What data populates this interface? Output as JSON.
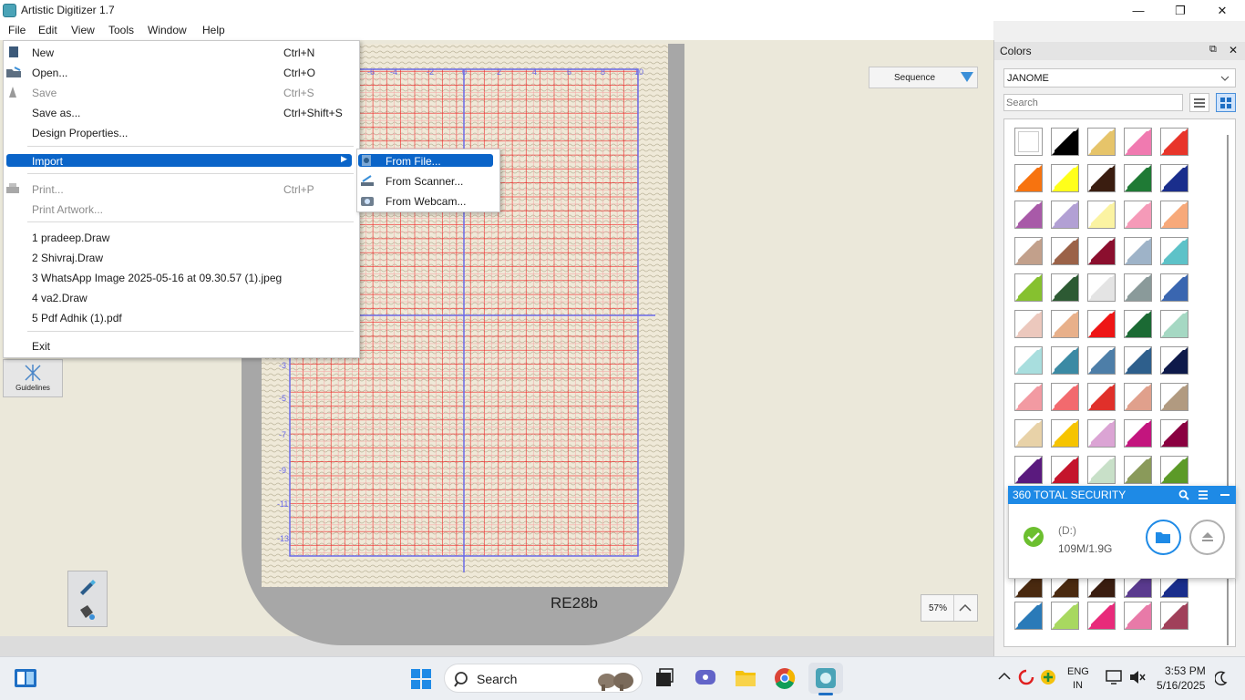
{
  "window": {
    "title": "Artistic Digitizer 1.7",
    "min": "—",
    "max": "❐",
    "close": "✕"
  },
  "menubar": [
    "File",
    "Edit",
    "View",
    "Tools",
    "Window",
    "Help"
  ],
  "file_menu": {
    "items": [
      {
        "label": "New",
        "shortcut": "Ctrl+N"
      },
      {
        "label": "Open...",
        "shortcut": "Ctrl+O"
      },
      {
        "label": "Save",
        "shortcut": "Ctrl+S"
      },
      {
        "label": "Save as...",
        "shortcut": "Ctrl+Shift+S"
      },
      {
        "label": "Design Properties...",
        "shortcut": ""
      },
      {
        "label": "Import",
        "shortcut": ""
      },
      {
        "label": "Print...",
        "shortcut": "Ctrl+P"
      },
      {
        "label": "Print Artwork...",
        "shortcut": ""
      },
      {
        "label": "1 pradeep.Draw",
        "shortcut": ""
      },
      {
        "label": "2 Shivraj.Draw",
        "shortcut": ""
      },
      {
        "label": "3 WhatsApp Image 2025-05-16 at 09.30.57 (1).jpeg",
        "shortcut": ""
      },
      {
        "label": "4 va2.Draw",
        "shortcut": ""
      },
      {
        "label": "5 Pdf Adhik (1).pdf",
        "shortcut": ""
      },
      {
        "label": "Exit",
        "shortcut": ""
      }
    ]
  },
  "import_submenu": [
    "From File...",
    "From Scanner...",
    "From Webcam..."
  ],
  "canvas": {
    "sequence_label": "Sequence",
    "hoop_label": "RE28b",
    "guidelines_label": "Guidelines",
    "zoom": "57%",
    "ruler_top": [
      "-6",
      "-4",
      "-2",
      "0",
      "2",
      "4",
      "6",
      "8",
      "10"
    ],
    "ruler_left": [
      "-3",
      "-5",
      "-7",
      "-9",
      "-11",
      "-13"
    ]
  },
  "colors_panel": {
    "title": "Colors",
    "brand": "JANOME",
    "search_placeholder": "Search",
    "swatches": [
      [
        "#ffffff",
        "#000000",
        "#e6c46a",
        "#f07ab0",
        "#e8352a"
      ],
      [
        "#f7730f",
        "#ffff1a",
        "#3a1d10",
        "#1f7a35",
        "#1a2e8c"
      ],
      [
        "#a85aa8",
        "#b2a0d4",
        "#fbf3a2",
        "#f59ab8",
        "#f7a97a"
      ],
      [
        "#c2a08b",
        "#9b6248",
        "#8b0f2e",
        "#9eb3c8",
        "#5dc2c8"
      ],
      [
        "#86c12f",
        "#2d5a33",
        "#e4e4e4",
        "#8a9a9a",
        "#3a66b0"
      ],
      [
        "#ecc8bd",
        "#e8b08a",
        "#ee1515",
        "#1b6a34",
        "#a5d8c3"
      ],
      [
        "#a8dede",
        "#3b8aa4",
        "#4d7ea8",
        "#2e5f8c",
        "#0e1a4a"
      ],
      [
        "#f29aa2",
        "#f26a6e",
        "#e0302a",
        "#e0a08c",
        "#b19a80"
      ],
      [
        "#e8d2a8",
        "#f6c400",
        "#dba4d4",
        "#c3157e",
        "#8a0040"
      ],
      [
        "#5a1a7e",
        "#c4152c",
        "#c8e0c8",
        "#8a9a5a",
        "#5c9a28"
      ],
      [
        "#4a2a10",
        "#4a2a10",
        "#3a1d10",
        "#5a3a8e",
        "#1a2e8c"
      ],
      [
        "#2a7ab8",
        "#a8d860",
        "#e82a7a",
        "#e87aa8",
        "#a0405a"
      ]
    ]
  },
  "security_popup": {
    "title": "360 TOTAL SECURITY",
    "drive": "(D:)",
    "usage": "109M/1.9G"
  },
  "taskbar": {
    "search_placeholder": "Search",
    "lang_top": "ENG",
    "lang_bottom": "IN",
    "time": "3:53 PM",
    "date": "5/16/2025"
  }
}
